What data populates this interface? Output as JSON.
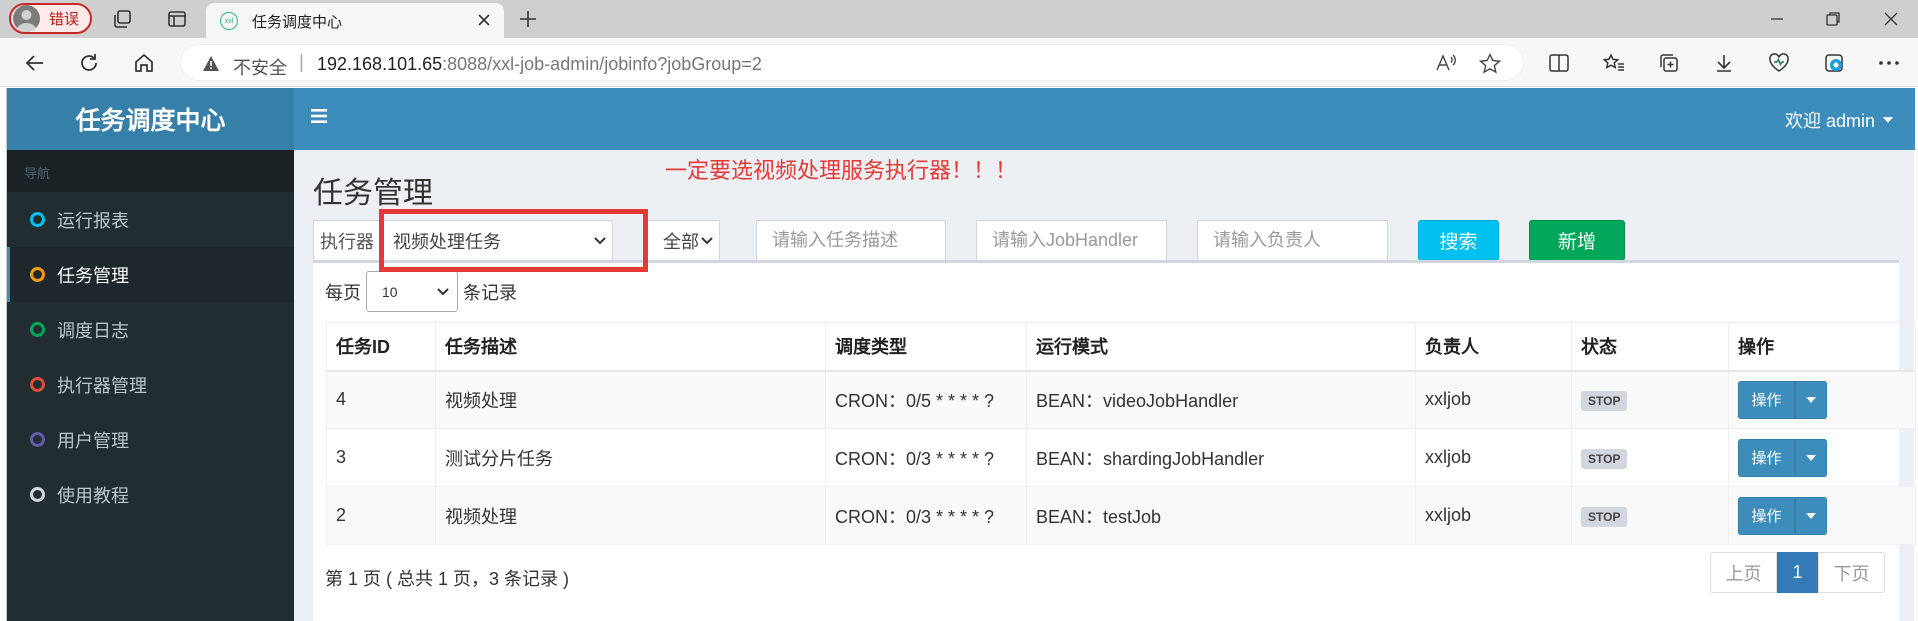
{
  "browser": {
    "profile_label": "错误",
    "tab_title": "任务调度中心",
    "security_label": "不安全",
    "url_host": "192.168.101.65",
    "url_rest": ":8088/xxl-job-admin/jobinfo?jobGroup=2"
  },
  "app": {
    "brand": "任务调度中心",
    "user_greeting": "欢迎 admin",
    "nav_header": "导航",
    "sidebar": [
      {
        "label": "运行报表",
        "color": "#00c0ef"
      },
      {
        "label": "任务管理",
        "color": "#f39c12"
      },
      {
        "label": "调度日志",
        "color": "#00a65a"
      },
      {
        "label": "执行器管理",
        "color": "#dd4b39"
      },
      {
        "label": "用户管理",
        "color": "#605ca8"
      },
      {
        "label": "使用教程",
        "color": "#d2d6de"
      }
    ],
    "page_title": "任务管理",
    "annotation": "一定要选视频处理服务执行器！！！",
    "filters": {
      "executor_label": "执行器",
      "executor_value": "视频处理任务",
      "status_value": "全部",
      "desc_placeholder": "请输入任务描述",
      "handler_placeholder": "请输入JobHandler",
      "author_placeholder": "请输入负责人",
      "search_label": "搜索",
      "add_label": "新增"
    },
    "per_page_label": "每页",
    "per_page_value": "10",
    "records_label": "条记录",
    "table": {
      "headers": [
        "任务ID",
        "任务描述",
        "调度类型",
        "运行模式",
        "负责人",
        "状态",
        "操作"
      ],
      "rows": [
        {
          "id": "4",
          "desc": "视频处理",
          "schedule": "CRON：0/5 * * * * ?",
          "mode": "BEAN：videoJobHandler",
          "owner": "xxljob",
          "status": "STOP",
          "op": "操作"
        },
        {
          "id": "3",
          "desc": "测试分片任务",
          "schedule": "CRON：0/3 * * * * ?",
          "mode": "BEAN：shardingJobHandler",
          "owner": "xxljob",
          "status": "STOP",
          "op": "操作"
        },
        {
          "id": "2",
          "desc": "视频处理",
          "schedule": "CRON：0/3 * * * * ?",
          "mode": "BEAN：testJob",
          "owner": "xxljob",
          "status": "STOP",
          "op": "操作"
        }
      ]
    },
    "page_info": "第 1 页 ( 总共 1 页，3 条记录 )",
    "pager": {
      "prev": "上页",
      "current": "1",
      "next": "下页"
    }
  }
}
